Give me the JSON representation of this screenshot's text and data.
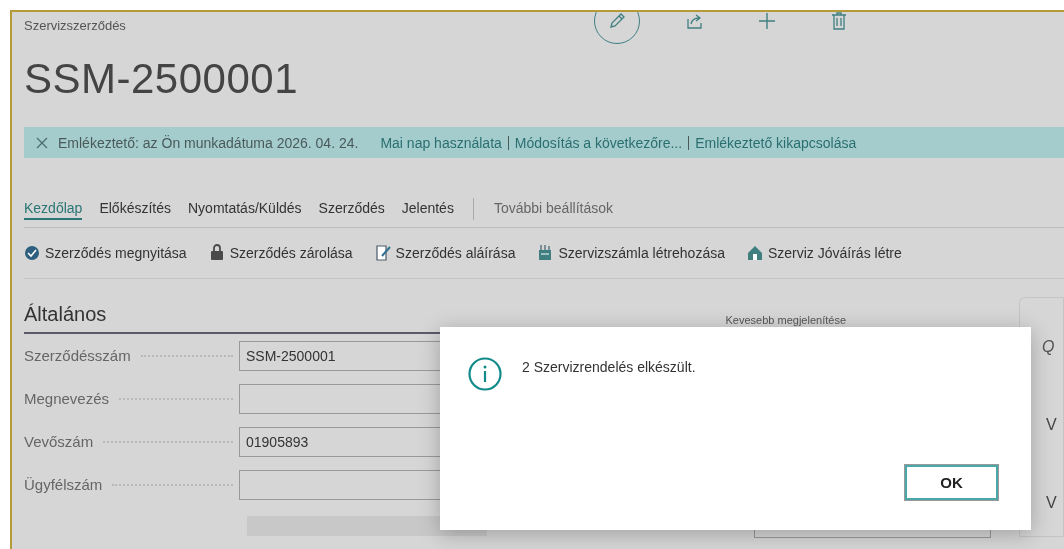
{
  "page": {
    "caption": "Szervizszerződés",
    "title": "SSM-2500001"
  },
  "toolbar": [
    {
      "kind": "edit"
    },
    {
      "kind": "share"
    },
    {
      "kind": "new"
    },
    {
      "kind": "delete"
    }
  ],
  "notification": {
    "text": "Emlékeztető: az Ön munkadátuma 2026. 04. 24.",
    "links": [
      "Mai nap használata",
      "Módosítás a következőre...",
      "Emlékeztető kikapcsolása"
    ]
  },
  "tabs": [
    {
      "label": "Kezdőlap",
      "selected": true
    },
    {
      "label": "Előkészítés",
      "selected": false
    },
    {
      "label": "Nyomtatás/Küldés",
      "selected": false
    },
    {
      "label": "Szerződés",
      "selected": false
    },
    {
      "label": "Jelentés",
      "selected": false
    }
  ],
  "more_options": "További beállítások",
  "actions": [
    {
      "label": "Szerződés megnyitása",
      "kind": "open"
    },
    {
      "label": "Szerződés zárolása",
      "kind": "lock"
    },
    {
      "label": "Szerződés aláírása",
      "kind": "sign"
    },
    {
      "label": "Szervizszámla létrehozása",
      "kind": "invoice"
    },
    {
      "label": "Szerviz Jóváírás létre",
      "kind": "credit"
    }
  ],
  "section": {
    "title": "Általános",
    "toggle": "Kevesebb megjelenítése",
    "fields": [
      {
        "label": "Szerződésszám",
        "value": "SSM-2500001"
      },
      {
        "label": "Megnevezés"
      },
      {
        "label": "Vevőszám",
        "value": "01905893"
      },
      {
        "label": "Ügyfélszám"
      }
    ]
  },
  "factbox": {
    "texts": [
      "Q",
      "V",
      "V"
    ]
  },
  "dialog": {
    "message": "2 Szervizrendelés elkészült.",
    "buttons": [
      "OK"
    ]
  }
}
